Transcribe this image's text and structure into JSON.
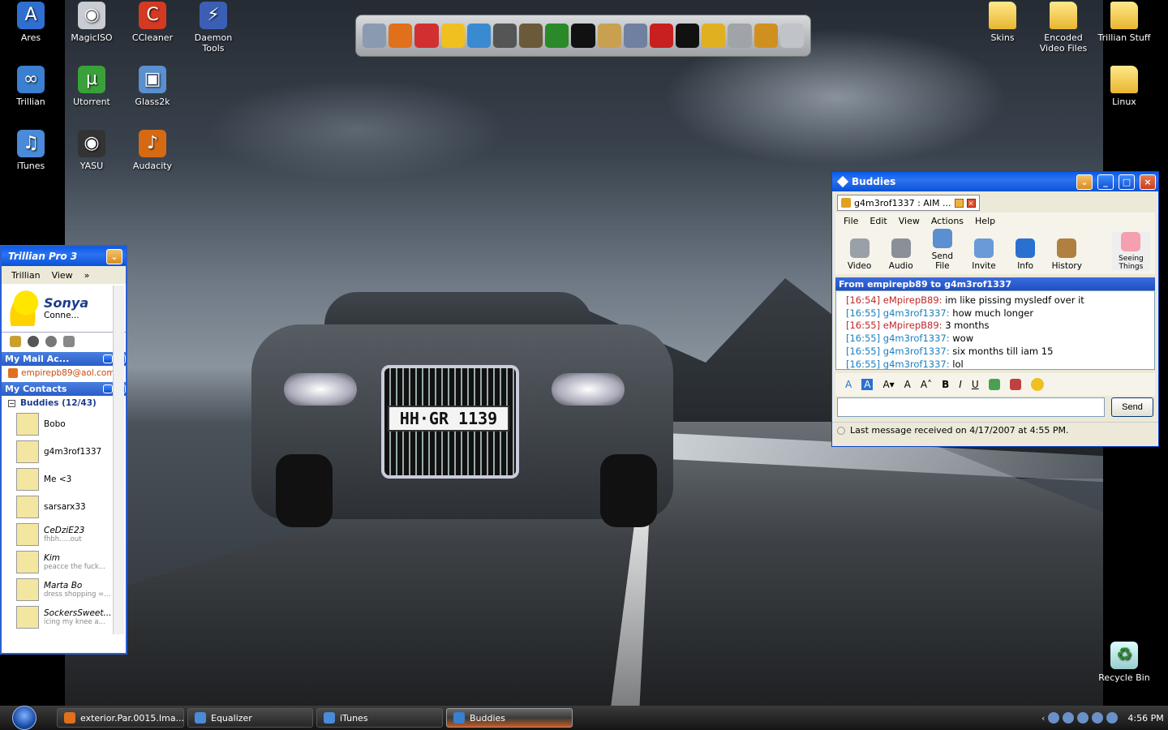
{
  "desktop": {
    "icons_left": [
      {
        "label": "Ares",
        "icon": "ares-icon",
        "color": "#2f6fd0",
        "glyph": "A"
      },
      {
        "label": "MagicISO",
        "icon": "disc-icon",
        "color": "#c9ccd2",
        "glyph": "◉"
      },
      {
        "label": "CCleaner",
        "icon": "ccleaner-icon",
        "color": "#d43a22",
        "glyph": "C"
      },
      {
        "label": "Daemon Tools",
        "icon": "daemon-tools-icon",
        "color": "#3a5fb5",
        "glyph": "⚡"
      },
      {
        "label": "Trillian",
        "icon": "trillian-icon",
        "color": "#3a7fd0",
        "glyph": "∞"
      },
      {
        "label": "Utorrent",
        "icon": "utorrent-icon",
        "color": "#3aa13a",
        "glyph": "µ"
      },
      {
        "label": "Glass2k",
        "icon": "glass2k-icon",
        "color": "#5a90d0",
        "glyph": "▣"
      },
      {
        "label": "iTunes",
        "icon": "itunes-icon",
        "color": "#4a8ad8",
        "glyph": "♫"
      },
      {
        "label": "YASU",
        "icon": "yasu-icon",
        "color": "#333333",
        "glyph": "◉"
      },
      {
        "label": "Audacity",
        "icon": "audacity-icon",
        "color": "#d66a12",
        "glyph": "♪"
      }
    ],
    "icons_right": [
      {
        "label": "Skins",
        "icon": "folder-icon"
      },
      {
        "label": "Encoded Video Files",
        "icon": "folder-icon"
      },
      {
        "label": "Trillian Stuff",
        "icon": "folder-icon"
      },
      {
        "label": "Linux",
        "icon": "folder-icon"
      },
      {
        "label": "Recycle Bin",
        "icon": "recycle-bin-icon"
      }
    ],
    "license_plate": "HH·GR 1139"
  },
  "dock": {
    "items": [
      {
        "icon": "drive-icon",
        "color": "#8a9ab0"
      },
      {
        "icon": "firefox-icon",
        "color": "#e0701c"
      },
      {
        "icon": "se-icon",
        "color": "#d23030"
      },
      {
        "icon": "smiley-icon",
        "color": "#f0c020"
      },
      {
        "icon": "aim-triangle-icon",
        "color": "#3a8ad0"
      },
      {
        "icon": "battlefield-icon",
        "color": "#555555"
      },
      {
        "icon": "battlefield2-icon",
        "color": "#6a5a3a"
      },
      {
        "icon": "film-icon",
        "color": "#2a8a2a"
      },
      {
        "icon": "steam-icon",
        "color": "#111111"
      },
      {
        "icon": "documents-icon",
        "color": "#c8a050"
      },
      {
        "icon": "clapper-icon",
        "color": "#7080a0"
      },
      {
        "icon": "pdf-icon",
        "color": "#c82020"
      },
      {
        "icon": "pen-icon",
        "color": "#111111"
      },
      {
        "icon": "pencils-icon",
        "color": "#e0b020"
      },
      {
        "icon": "glass-icon",
        "color": "#a0a4a8"
      },
      {
        "icon": "tools-icon",
        "color": "#d09020"
      },
      {
        "icon": "trash-icon",
        "color": "#c0c4c8"
      }
    ]
  },
  "trillian": {
    "title": "Trillian Pro 3",
    "menu": [
      "Trillian",
      "View",
      "»"
    ],
    "profile_name": "Sonya",
    "profile_status": "Conne...",
    "mail_section": "My Mail Ac...",
    "mail_account": "empirepb89@aol.com",
    "contacts_section": "My Contacts",
    "group": "Buddies (12/43)",
    "contacts": [
      {
        "name": "Bobo",
        "status": ""
      },
      {
        "name": "g4m3rof1337",
        "status": ""
      },
      {
        "name": "Me <3",
        "status": ""
      },
      {
        "name": "sarsarx33",
        "status": ""
      },
      {
        "name": "CeDziE23",
        "status": "fhbh.....out"
      },
      {
        "name": "Kim",
        "status": "peacce the fuck..."
      },
      {
        "name": "Marta Bo",
        "status": "dress shopping =..."
      },
      {
        "name": "SockersSweet...",
        "status": "icing my knee a..."
      }
    ]
  },
  "buddies": {
    "title": "Buddies",
    "tab": "g4m3rof1337 : AIM ...",
    "menu": [
      "File",
      "Edit",
      "View",
      "Actions",
      "Help"
    ],
    "tools": [
      {
        "label": "Video",
        "icon": "video-icon",
        "color": "#9aa0a8"
      },
      {
        "label": "Audio",
        "icon": "microphone-icon",
        "color": "#8a9098"
      },
      {
        "label": "Send File",
        "icon": "send-file-icon",
        "color": "#5a90d0"
      },
      {
        "label": "Invite",
        "icon": "invite-icon",
        "color": "#6a9ad8"
      },
      {
        "label": "Info",
        "icon": "info-icon",
        "color": "#2a70d0"
      },
      {
        "label": "History",
        "icon": "history-icon",
        "color": "#b08040"
      }
    ],
    "seeing_things": "Seeing Things",
    "conversation_header": "From empirepb89 to g4m3rof1337",
    "messages": [
      {
        "time": "[16:54]",
        "user": "eMpirepB89:",
        "text": "im like pissing mysledf over it",
        "side": "r"
      },
      {
        "time": "[16:55]",
        "user": "g4m3rof1337:",
        "text": "how much longer",
        "side": "b"
      },
      {
        "time": "[16:55]",
        "user": "eMpirepB89:",
        "text": "3 months",
        "side": "r"
      },
      {
        "time": "[16:55]",
        "user": "g4m3rof1337:",
        "text": "wow",
        "side": "b"
      },
      {
        "time": "[16:55]",
        "user": "g4m3rof1337:",
        "text": "six months till iam 15",
        "side": "b"
      },
      {
        "time": "[16:55]",
        "user": "g4m3rof1337:",
        "text": "lol",
        "side": "b"
      }
    ],
    "send_label": "Send",
    "status_text": "Last message received on 4/17/2007 at 4:55 PM."
  },
  "taskbar": {
    "tasks": [
      {
        "label": "exterior.Par.0015.Ima...",
        "icon": "firefox-icon",
        "color": "#e0701c",
        "active": false
      },
      {
        "label": "Equalizer",
        "icon": "itunes-icon",
        "color": "#4a8ad8",
        "active": false
      },
      {
        "label": "iTunes",
        "icon": "itunes-icon",
        "color": "#4a8ad8",
        "active": false
      },
      {
        "label": "Buddies",
        "icon": "trillian-icon",
        "color": "#3a7fd0",
        "active": true
      }
    ],
    "clock": "4:56 PM"
  }
}
